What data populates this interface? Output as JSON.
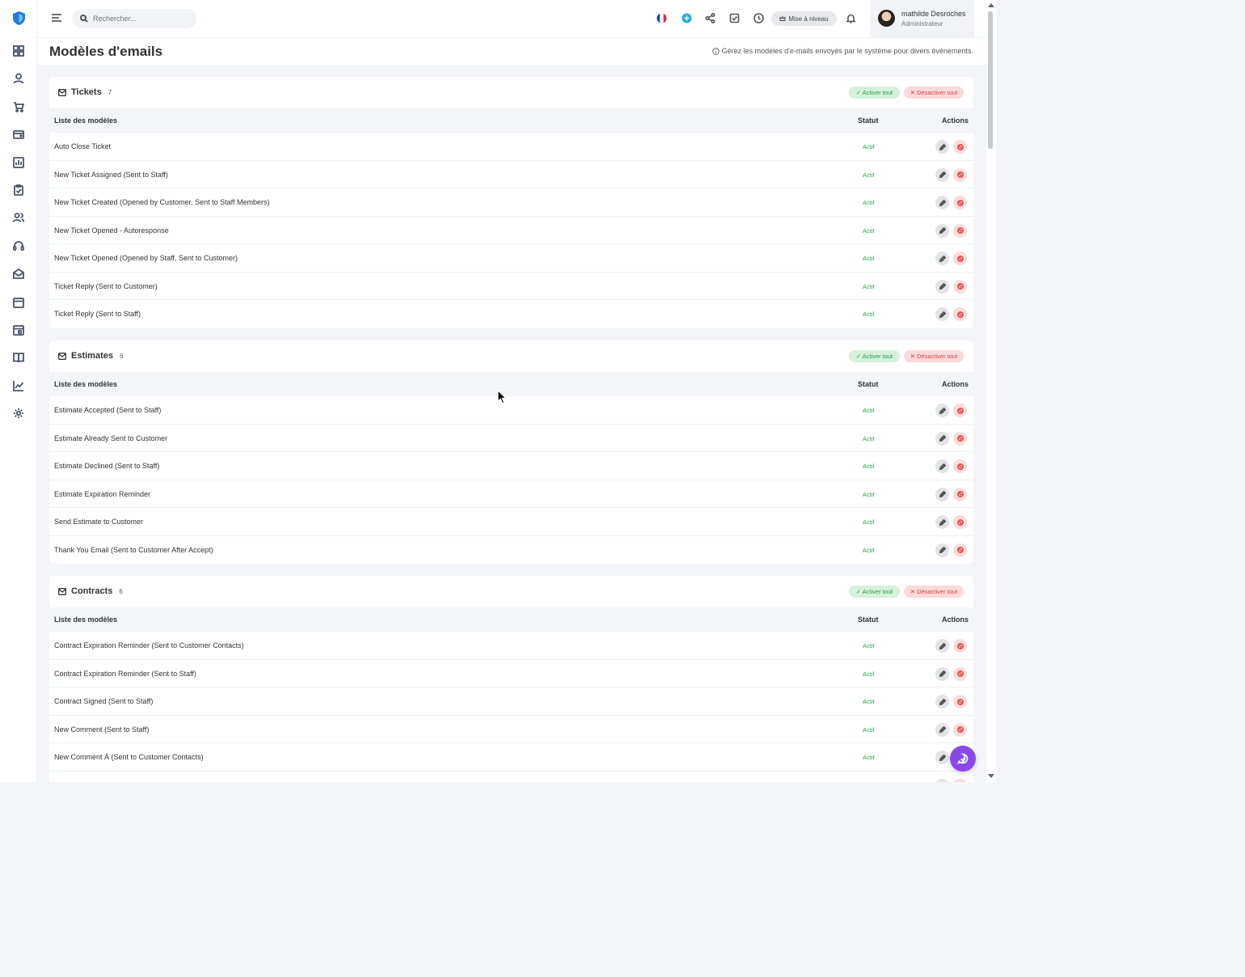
{
  "search": {
    "placeholder": "Rechercher..."
  },
  "topbar": {
    "upgrade_label": "Mise à niveau"
  },
  "user": {
    "name": "mathilde Desroches",
    "role": "Administrateur"
  },
  "page": {
    "title": "Modèles d'emails",
    "description": "Gérez les modèles d'e-mails envoyés par le système pour divers événements."
  },
  "table_headers": {
    "list": "Liste des modèles",
    "status": "Statut",
    "actions": "Actions"
  },
  "section_buttons": {
    "enable_all": "✓ Activer tout",
    "disable_all": "✕ Désactiver tout"
  },
  "status_active": "Actif",
  "sections": [
    {
      "title": "Tickets",
      "count": "7",
      "rows": [
        "Auto Close Ticket",
        "New Ticket Assigned (Sent to Staff)",
        "New Ticket Created (Opened by Customer, Sent to Staff Members)",
        "New Ticket Opened - Autoresponse",
        "New Ticket Opened (Opened by Staff, Sent to Customer)",
        "Ticket Reply (Sent to Customer)",
        "Ticket Reply (Sent to Staff)"
      ]
    },
    {
      "title": "Estimates",
      "count": "6",
      "rows": [
        "Estimate Accepted (Sent to Staff)",
        "Estimate Already Sent to Customer",
        "Estimate Declined (Sent to Staff)",
        "Estimate Expiration Reminder",
        "Send Estimate to Customer",
        "Thank You Email (Sent to Customer After Accept)"
      ]
    },
    {
      "title": "Contracts",
      "count": "6",
      "rows": [
        "Contract Expiration Reminder (Sent to Customer Contacts)",
        "Contract Expiration Reminder (Sent to Staff)",
        "Contract Signed (Sent to Staff)",
        "New Comment (Sent to Staff)",
        "New Comment À (Sent to Customer Contacts)",
        ""
      ]
    }
  ],
  "sidebar_icons": [
    "dashboard-icon",
    "user-icon",
    "cart-icon",
    "wallet-icon",
    "chart-bar-icon",
    "task-icon",
    "team-icon",
    "headset-icon",
    "mail-open-icon",
    "calendar-icon",
    "calendar-event-icon",
    "book-icon",
    "trend-icon",
    "gear-icon"
  ],
  "colors": {
    "active": "#2aa84a",
    "enable_bg": "#d5f1dc",
    "disable_bg": "#fbdada",
    "fab": "#8a48e8",
    "logo": "#1f7ae0"
  }
}
